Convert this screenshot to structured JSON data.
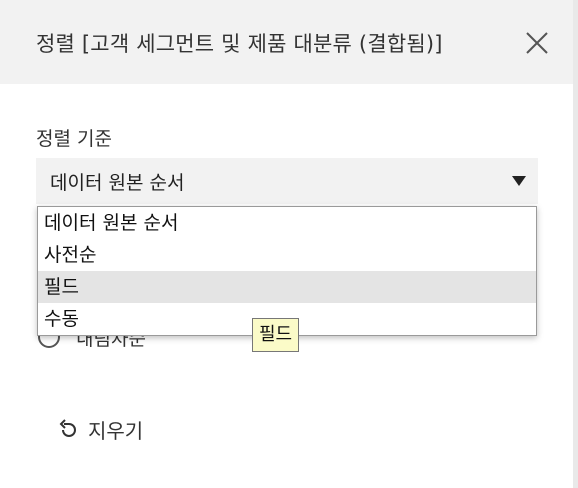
{
  "dialog": {
    "title": "정렬 [고객 세그먼트 및 제품 대분류 (결합됨)]",
    "close_icon": "close-icon"
  },
  "sort": {
    "label": "정렬 기준",
    "selected": "데이터 원본 순서",
    "options": [
      "데이터 원본 순서",
      "사전순",
      "필드",
      "수동"
    ],
    "hovered_option": "필드"
  },
  "tooltip": {
    "text": "필드"
  },
  "hidden_radio": {
    "label": "내림차순"
  },
  "footer": {
    "clear_label": "지우기",
    "clear_icon": "undo-icon"
  }
}
